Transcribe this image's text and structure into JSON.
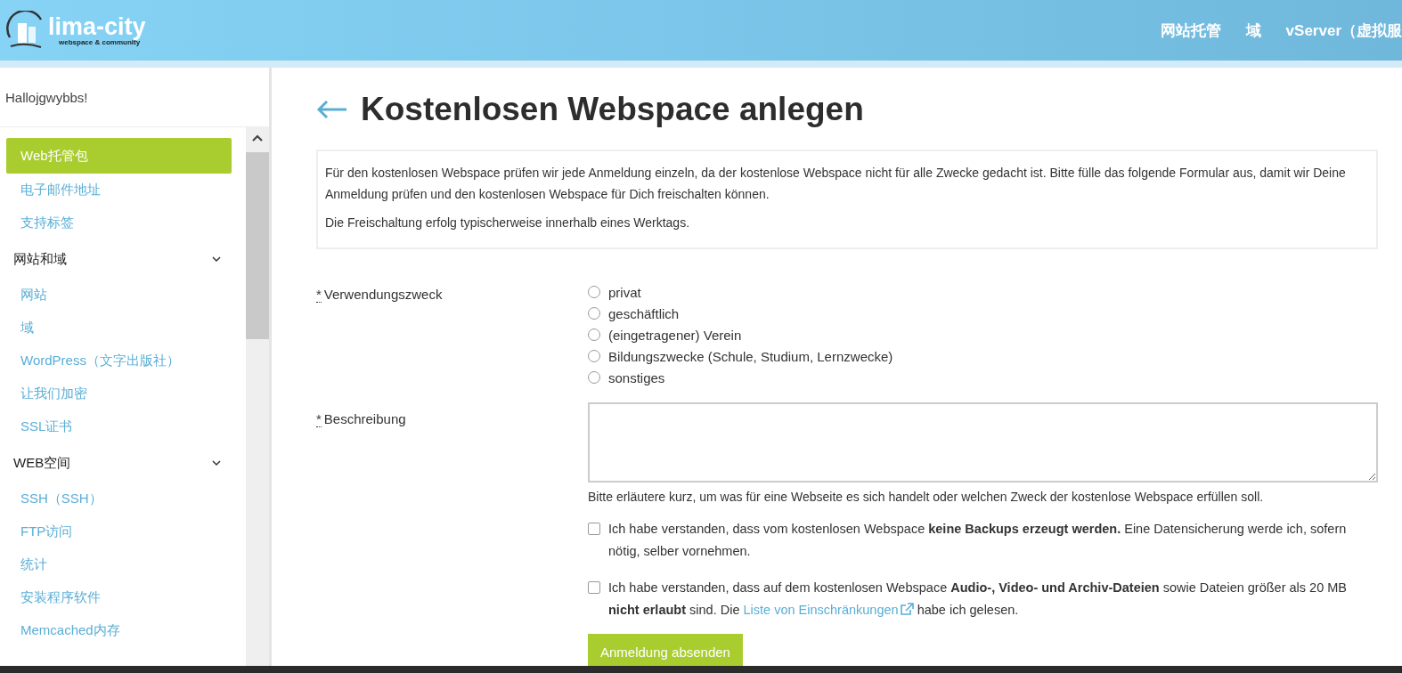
{
  "header": {
    "logo": {
      "name": "lima-city",
      "tagline": "webspace & community"
    },
    "nav": [
      "网站托管",
      "域",
      "vServer（虚拟服"
    ]
  },
  "sidebar": {
    "greeting": "Hallojgwybbs!",
    "items": [
      {
        "kind": "link",
        "label": "Web托管包",
        "selected": true
      },
      {
        "kind": "link",
        "label": "电子邮件地址",
        "selected": false
      },
      {
        "kind": "link",
        "label": "支持标签",
        "selected": false
      },
      {
        "kind": "group",
        "label": "网站和域",
        "expanded": true,
        "children": [
          {
            "kind": "link",
            "label": "网站",
            "selected": false
          },
          {
            "kind": "link",
            "label": "域",
            "selected": false
          },
          {
            "kind": "link",
            "label": "WordPress（文字出版社）",
            "selected": false
          },
          {
            "kind": "link",
            "label": "让我们加密",
            "selected": false
          },
          {
            "kind": "link",
            "label": "SSL证书",
            "selected": false
          }
        ]
      },
      {
        "kind": "group",
        "label": "WEB空间",
        "expanded": true,
        "children": [
          {
            "kind": "link",
            "label": "SSH（SSH）",
            "selected": false
          },
          {
            "kind": "link",
            "label": "FTP访问",
            "selected": false
          },
          {
            "kind": "link",
            "label": "统计",
            "selected": false
          },
          {
            "kind": "link",
            "label": "安装程序软件",
            "selected": false
          },
          {
            "kind": "link",
            "label": "Memcached内存",
            "selected": false
          }
        ]
      }
    ]
  },
  "page": {
    "title": "Kostenlosen Webspace anlegen",
    "info": [
      "Für den kostenlosen Webspace prüfen wir jede Anmeldung einzeln, da der kostenlose Webspace nicht für alle Zwecke gedacht ist. Bitte fülle das folgende Formular aus, damit wir Deine Anmeldung prüfen und den kostenlosen Webspace für Dich freischalten können.",
      "Die Freischaltung erfolg typischerweise innerhalb eines Werktags."
    ],
    "purpose": {
      "required": "*",
      "label": "Verwendungszweck",
      "options": [
        {
          "label": "privat",
          "selected": false
        },
        {
          "label": "geschäftlich",
          "selected": false
        },
        {
          "label": "(eingetragener) Verein",
          "selected": false
        },
        {
          "label": "Bildungszwecke (Schule, Studium, Lernzwecke)",
          "selected": false
        },
        {
          "label": "sonstiges",
          "selected": false
        }
      ]
    },
    "description": {
      "required": "*",
      "label": "Beschreibung",
      "hint": "Bitte erläutere kurz, um was für eine Webseite es sich handelt oder welchen Zweck der kostenlose Webspace erfüllen soll."
    },
    "consents": [
      {
        "checked": false,
        "parts": [
          {
            "kind": "text",
            "text": "Ich habe verstanden, dass vom kostenlosen Webspace **keine Backups erzeugt werden.** Eine Datensicherung werde ich, sofern nötig, selber vornehmen."
          }
        ]
      },
      {
        "checked": false,
        "parts": [
          {
            "kind": "text",
            "text": "Ich habe verstanden, dass auf dem kostenlosen Webspace **Audio-, Video- und Archiv-Dateien** sowie Dateien größer als 20 MB **nicht erlaubt** sind. Die "
          },
          {
            "kind": "link",
            "text": "Liste von Einschränkungen"
          },
          {
            "kind": "text",
            "text": " habe ich gelesen."
          }
        ]
      }
    ],
    "submit": "Anmeldung absenden"
  }
}
